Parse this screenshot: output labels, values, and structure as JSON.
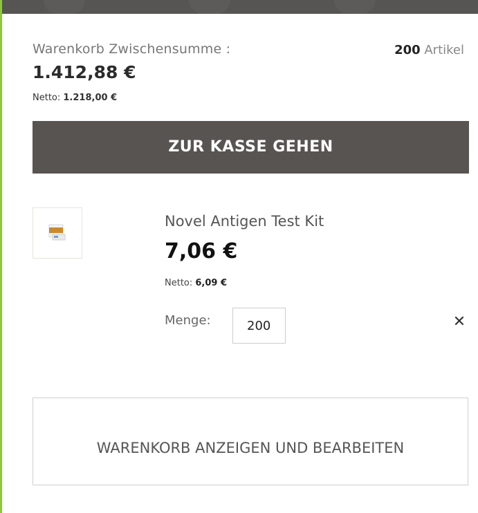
{
  "cart": {
    "subtotal_label": "Warenkorb Zwischensumme :",
    "item_count": "200",
    "item_count_suffix": " Artikel",
    "subtotal_value": "1.412,88 €",
    "netto_label": "Netto: ",
    "netto_value": "1.218,00 €",
    "checkout_label": "ZUR KASSE GEHEN",
    "view_cart_label": "WARENKORB ANZEIGEN UND BEARBEITEN"
  },
  "item": {
    "name": "Novel Antigen Test Kit",
    "price": "7,06 €",
    "netto_label": "Netto: ",
    "netto_value": "6,09 €",
    "qty_label": "Menge:",
    "qty_value": "200",
    "remove_icon": "close-icon"
  },
  "colors": {
    "accent_border": "#8dc63f",
    "checkout_button": "#585452",
    "top_bar": "#575553"
  }
}
